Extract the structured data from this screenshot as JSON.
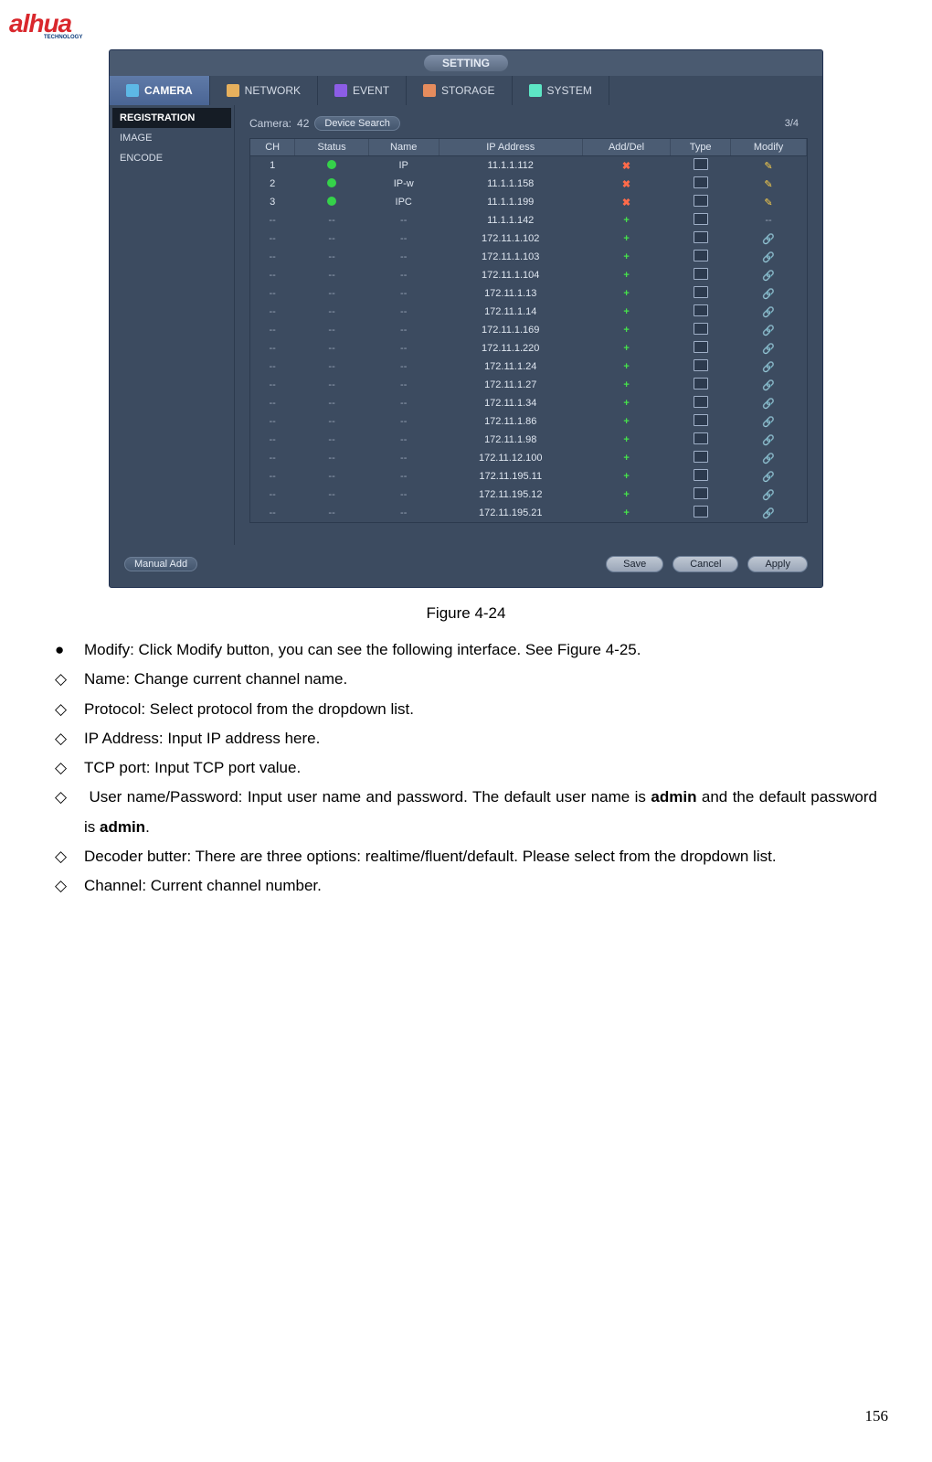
{
  "logo": {
    "brand": "alhua",
    "sub": "TECHNOLOGY"
  },
  "ui": {
    "header_tab": "SETTING",
    "tabs": {
      "camera": "CAMERA",
      "network": "NETWORK",
      "event": "EVENT",
      "storage": "STORAGE",
      "system": "SYSTEM"
    },
    "sidebar": {
      "registration": "REGISTRATION",
      "image": "IMAGE",
      "encode": "ENCODE"
    },
    "toolbar": {
      "camera_label": "Camera:",
      "camera_value": "42",
      "device_search": "Device Search",
      "counter": "3/4",
      "manual_add": "Manual Add",
      "save": "Save",
      "cancel": "Cancel",
      "apply": "Apply"
    },
    "columns": {
      "ch": "CH",
      "status": "Status",
      "name": "Name",
      "ip": "IP Address",
      "adddel": "Add/Del",
      "type": "Type",
      "modify": "Modify"
    },
    "rows": [
      {
        "ch": "1",
        "status": "green",
        "name": "IP",
        "ip": "11.1.1.112",
        "add": "x",
        "modify": "edit"
      },
      {
        "ch": "2",
        "status": "green",
        "name": "IP-w",
        "ip": "11.1.1.158",
        "add": "x",
        "modify": "edit"
      },
      {
        "ch": "3",
        "status": "green",
        "name": "IPC",
        "ip": "11.1.1.199",
        "add": "x",
        "modify": "edit"
      },
      {
        "ch": "--",
        "status": "--",
        "name": "--",
        "ip": "11.1.1.142",
        "add": "+",
        "modify": "--"
      },
      {
        "ch": "--",
        "status": "--",
        "name": "--",
        "ip": "172.11.1.102",
        "add": "+",
        "modify": "dim"
      },
      {
        "ch": "--",
        "status": "--",
        "name": "--",
        "ip": "172.11.1.103",
        "add": "+",
        "modify": "dim"
      },
      {
        "ch": "--",
        "status": "--",
        "name": "--",
        "ip": "172.11.1.104",
        "add": "+",
        "modify": "dim"
      },
      {
        "ch": "--",
        "status": "--",
        "name": "--",
        "ip": "172.11.1.13",
        "add": "+",
        "modify": "dim"
      },
      {
        "ch": "--",
        "status": "--",
        "name": "--",
        "ip": "172.11.1.14",
        "add": "+",
        "modify": "dim"
      },
      {
        "ch": "--",
        "status": "--",
        "name": "--",
        "ip": "172.11.1.169",
        "add": "+",
        "modify": "dim"
      },
      {
        "ch": "--",
        "status": "--",
        "name": "--",
        "ip": "172.11.1.220",
        "add": "+",
        "modify": "dim"
      },
      {
        "ch": "--",
        "status": "--",
        "name": "--",
        "ip": "172.11.1.24",
        "add": "+",
        "modify": "dim"
      },
      {
        "ch": "--",
        "status": "--",
        "name": "--",
        "ip": "172.11.1.27",
        "add": "+",
        "modify": "dim"
      },
      {
        "ch": "--",
        "status": "--",
        "name": "--",
        "ip": "172.11.1.34",
        "add": "+",
        "modify": "dim"
      },
      {
        "ch": "--",
        "status": "--",
        "name": "--",
        "ip": "172.11.1.86",
        "add": "+",
        "modify": "dim"
      },
      {
        "ch": "--",
        "status": "--",
        "name": "--",
        "ip": "172.11.1.98",
        "add": "+",
        "modify": "dim"
      },
      {
        "ch": "--",
        "status": "--",
        "name": "--",
        "ip": "172.11.12.100",
        "add": "+",
        "modify": "dim"
      },
      {
        "ch": "--",
        "status": "--",
        "name": "--",
        "ip": "172.11.195.11",
        "add": "+",
        "modify": "dim"
      },
      {
        "ch": "--",
        "status": "--",
        "name": "--",
        "ip": "172.11.195.12",
        "add": "+",
        "modify": "dim"
      },
      {
        "ch": "--",
        "status": "--",
        "name": "--",
        "ip": "172.11.195.21",
        "add": "+",
        "modify": "dim"
      }
    ]
  },
  "caption": "Figure 4-24",
  "list": {
    "modify": "Modify: Click Modify button, you can see the following interface. See Figure 4-25.",
    "name": "Name: Change current channel name.",
    "protocol": "Protocol: Select protocol from the dropdown list.",
    "ip": "IP Address: Input IP address here.",
    "tcp": "TCP port: Input TCP port value.",
    "user_a": "User name/Password: Input user name and password. The default user name is ",
    "user_b": "admin",
    "user_c": " and the default password is ",
    "user_d": "admin",
    "user_e": ".",
    "decoder": "Decoder butter: There are three options: realtime/fluent/default. Please select from the dropdown list.",
    "channel": "Channel: Current channel number."
  },
  "page_number": "156"
}
